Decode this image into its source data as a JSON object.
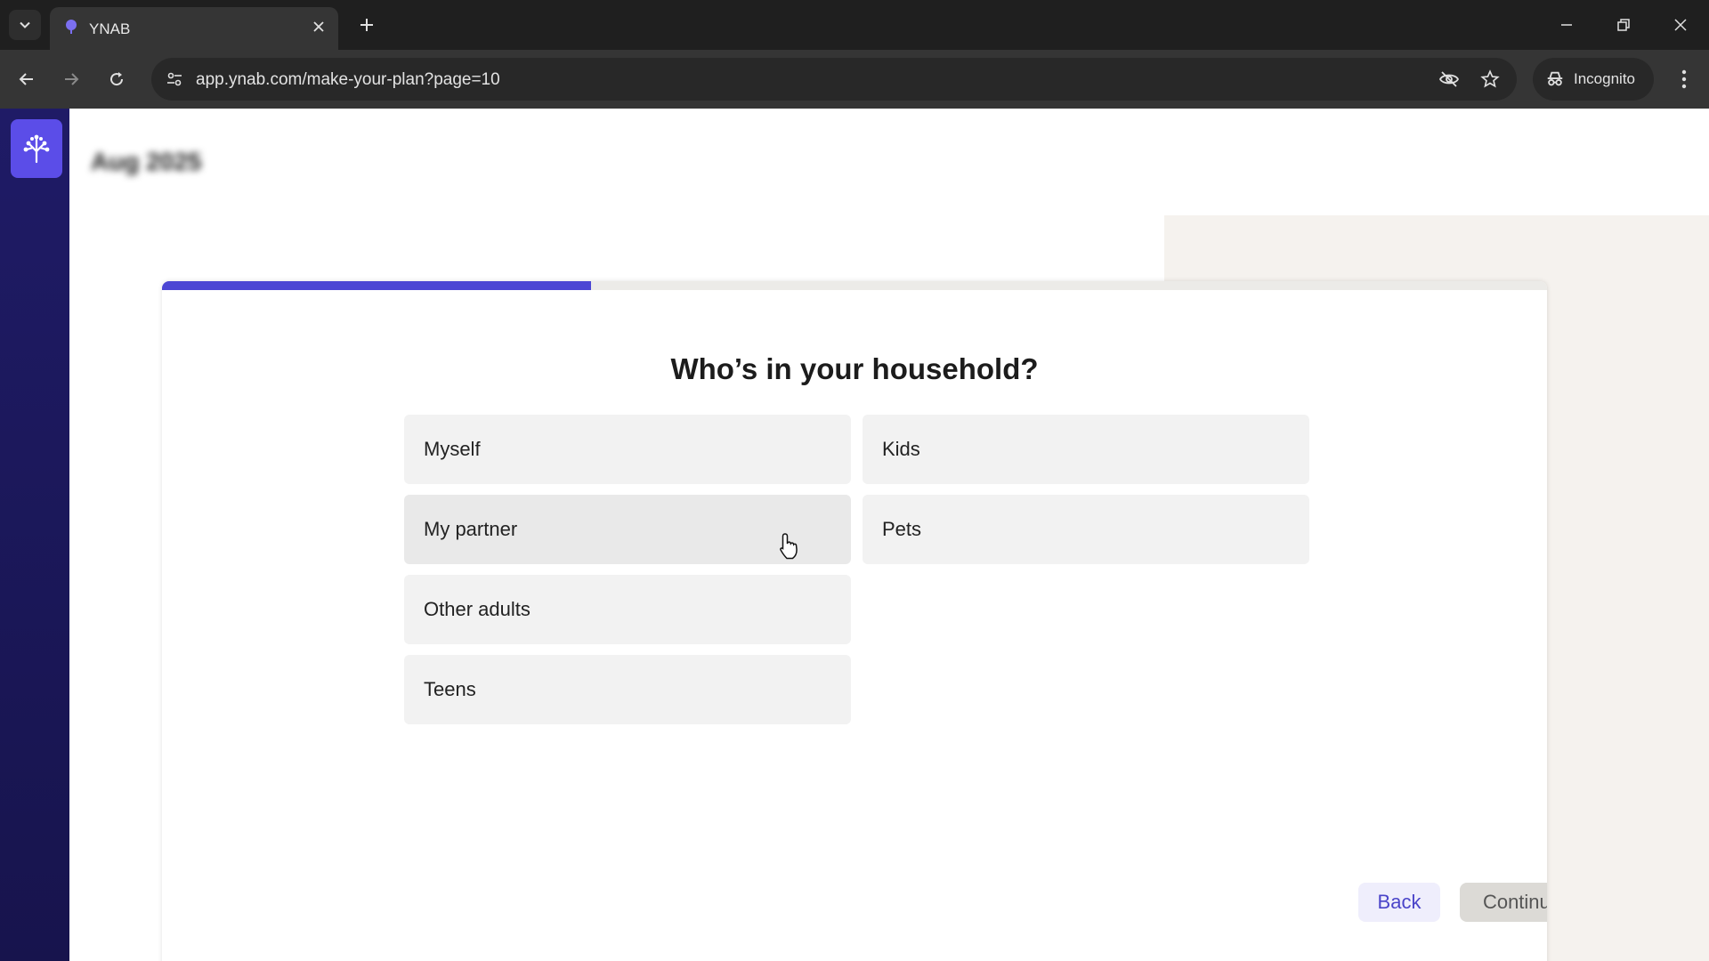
{
  "browser": {
    "tab": {
      "title": "YNAB"
    },
    "url": "app.ynab.com/make-your-plan?page=10",
    "incognito_label": "Incognito",
    "icons": {
      "tab_list": "chevron-down-icon",
      "tab_close": "close-icon",
      "new_tab": "plus-icon",
      "back": "arrow-left-icon",
      "forward": "arrow-right-icon",
      "reload": "reload-icon",
      "site_info": "tune-icon",
      "eye_off": "eye-off-icon",
      "bookmark": "star-icon",
      "incognito": "incognito-icon",
      "menu": "kebab-menu-icon"
    }
  },
  "app": {
    "month_title": "Aug 2025",
    "progress": 0.31,
    "question": "Who’s in your household?",
    "options_left": [
      "Myself",
      "My partner",
      "Other adults",
      "Teens"
    ],
    "options_right": [
      "Kids",
      "Pets"
    ],
    "buttons": {
      "back": "Back",
      "continue": "Continue"
    },
    "colors": {
      "accent": "#4c47d4",
      "sidebar": "#1f1b66",
      "logo_bg": "#5b4de8"
    }
  }
}
